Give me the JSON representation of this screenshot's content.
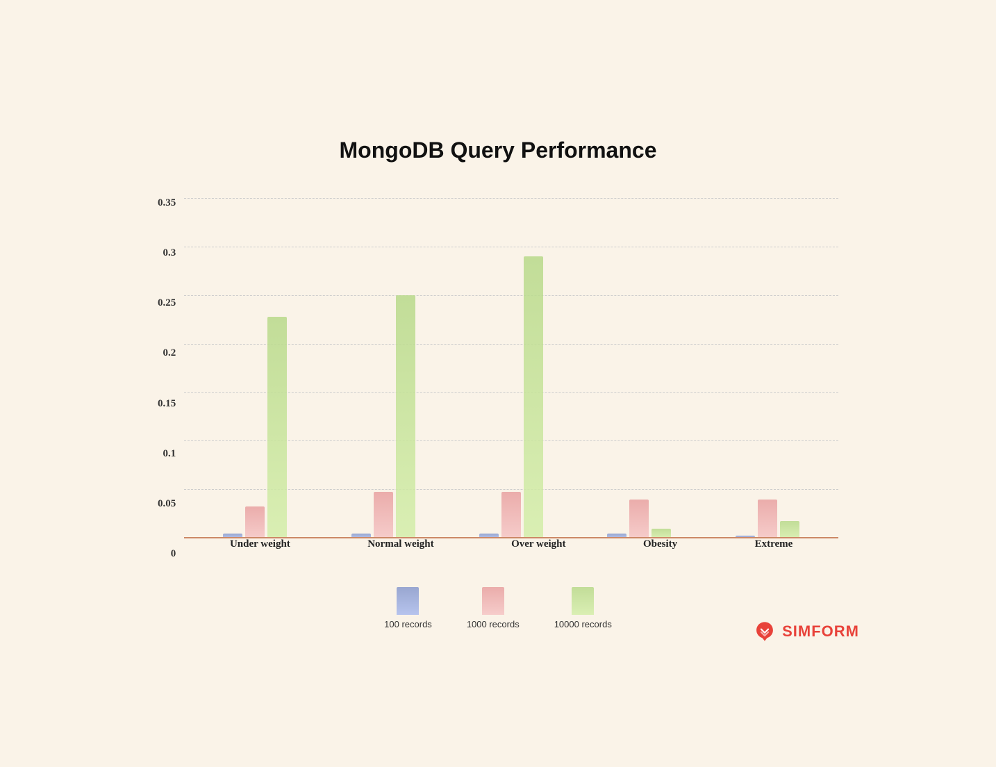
{
  "title": "MongoDB Query Performance",
  "yAxis": {
    "labels": [
      "0.35",
      "0.3",
      "0.25",
      "0.2",
      "0.15",
      "0.1",
      "0.05",
      "0"
    ]
  },
  "xAxis": {
    "labels": [
      "Under weight",
      "Normal weight",
      "Over weight",
      "Obesity",
      "Extreme"
    ]
  },
  "legend": {
    "items": [
      {
        "label": "100 records",
        "color100": true
      },
      {
        "label": "1000 records",
        "color1000": true
      },
      {
        "label": "10000 records",
        "color10000": true
      }
    ]
  },
  "groups": [
    {
      "name": "Under weight",
      "bar100": 0.005,
      "bar1000": 0.033,
      "bar10000": 0.228
    },
    {
      "name": "Normal weight",
      "bar100": 0.005,
      "bar1000": 0.048,
      "bar10000": 0.25
    },
    {
      "name": "Over weight",
      "bar100": 0.005,
      "bar1000": 0.048,
      "bar10000": 0.29
    },
    {
      "name": "Obesity",
      "bar100": 0.005,
      "bar1000": 0.04,
      "bar10000": 0.01
    },
    {
      "name": "Extreme",
      "bar100": 0.003,
      "bar1000": 0.04,
      "bar10000": 0.018
    }
  ],
  "maxValue": 0.35,
  "chartHeightPx": 490,
  "logo": {
    "text": "SIMFORM"
  }
}
